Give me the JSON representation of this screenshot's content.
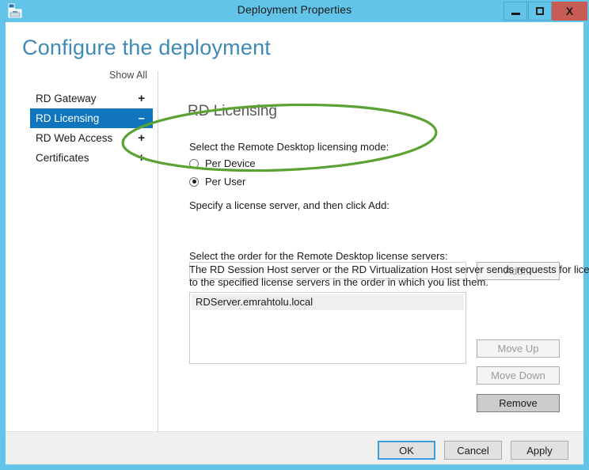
{
  "window": {
    "title": "Deployment Properties",
    "icon": "server-manager-icon",
    "accent_color": "#62c4e8",
    "close_color": "#c75b56",
    "caption": {
      "minimize": "minimize-icon",
      "maximize": "maximize-icon",
      "close": "X"
    }
  },
  "page": {
    "heading": "Configure the deployment",
    "heading_color": "#3f8ab5"
  },
  "nav": {
    "show_all_label": "Show All",
    "selected_color": "#1075bd",
    "items": [
      {
        "label": "RD Gateway",
        "sign": "+",
        "selected": false
      },
      {
        "label": "RD Licensing",
        "sign": "–",
        "selected": true
      },
      {
        "label": "RD Web Access",
        "sign": "+",
        "selected": false
      },
      {
        "label": "Certificates",
        "sign": "+",
        "selected": false
      }
    ]
  },
  "content": {
    "section_heading": "RD Licensing",
    "mode_label": "Select the Remote Desktop licensing mode:",
    "modes": [
      {
        "label": "Per Device",
        "checked": false
      },
      {
        "label": "Per User",
        "checked": true
      }
    ],
    "specify_label": "Specify a license server, and then click Add:",
    "license_input_value": "",
    "license_input_placeholder": "",
    "add_button": {
      "label": "Add...",
      "enabled": false
    },
    "order_label": "Select the order for the Remote Desktop license servers:",
    "order_description_line1": "The RD Session Host server or the RD Virtualization Host server sends requests for licenses",
    "order_description_line2": "to the specified license servers in the order in which you list them.",
    "server_list": [
      {
        "name": "RDServer.emrahtolu.local",
        "selected": true
      }
    ],
    "move_up_button": {
      "label": "Move Up",
      "enabled": false
    },
    "move_down_button": {
      "label": "Move Down",
      "enabled": false
    },
    "remove_button": {
      "label": "Remove",
      "enabled": true
    }
  },
  "annotation": {
    "shape": "ellipse",
    "color": "#5ba133",
    "stroke_width": 3
  },
  "footer": {
    "ok_label": "OK",
    "cancel_label": "Cancel",
    "apply_label": "Apply",
    "focus_color": "#3d9be0"
  }
}
